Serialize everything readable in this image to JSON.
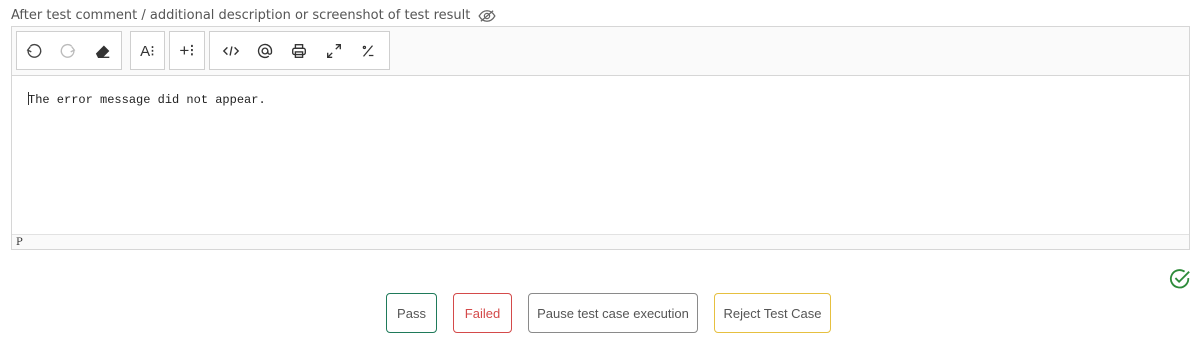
{
  "field": {
    "label": "After test comment / additional description or screenshot of test result",
    "label_icon": "eye-slash-icon"
  },
  "toolbar": {
    "groups": [
      {
        "buttons": [
          {
            "icon": "undo-icon"
          },
          {
            "icon": "redo-icon",
            "disabled": true
          },
          {
            "icon": "eraser-icon"
          }
        ]
      },
      {
        "buttons": [
          {
            "icon": "text-format-icon",
            "glyph": "A⁝"
          }
        ]
      },
      {
        "buttons": [
          {
            "icon": "insert-icon",
            "glyph": "+⁝"
          }
        ]
      },
      {
        "buttons": [
          {
            "icon": "code-icon"
          },
          {
            "icon": "mention-icon"
          },
          {
            "icon": "print-icon"
          },
          {
            "icon": "fullscreen-icon"
          },
          {
            "icon": "percent-icon"
          }
        ]
      }
    ]
  },
  "editor": {
    "content": "The error message did not appear.",
    "status": "P"
  },
  "status_icon": "check-circle-icon",
  "actions": {
    "pass": "Pass",
    "failed": "Failed",
    "pause": "Pause test case execution",
    "reject": "Reject Test Case"
  },
  "colors": {
    "pass_border": "#1f7a5a",
    "failed": "#d44a4a",
    "pause_border": "#8a8a8a",
    "reject_border": "#e6c040",
    "check": "#2e8b3a"
  }
}
